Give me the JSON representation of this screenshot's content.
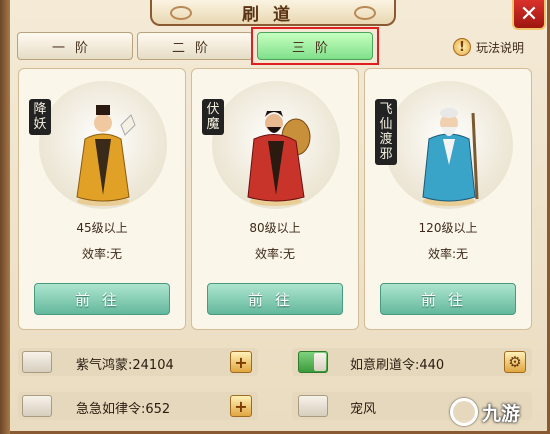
{
  "header": {
    "title": "刷道",
    "close_label": "✕"
  },
  "tabs": [
    {
      "label": "一阶",
      "active": false
    },
    {
      "label": "二阶",
      "active": false
    },
    {
      "label": "三阶",
      "active": true
    }
  ],
  "help": {
    "icon": "!",
    "label": "玩法说明"
  },
  "cards": [
    {
      "badge": "降妖",
      "level": "45级以上",
      "efficiency": "效率:无",
      "button": "前往",
      "robe_color": "#e0a126"
    },
    {
      "badge": "伏魔",
      "level": "80级以上",
      "efficiency": "效率:无",
      "button": "前往",
      "robe_color": "#c8342a"
    },
    {
      "badge": "飞仙渡邪",
      "level": "120级以上",
      "efficiency": "效率:无",
      "button": "前往",
      "robe_color": "#3aa3c8"
    }
  ],
  "items": [
    {
      "label": "紫气鸿蒙:24104",
      "toggle_on": false,
      "action": "+"
    },
    {
      "label": "如意刷道令:440",
      "toggle_on": true,
      "action": "⚙"
    },
    {
      "label": "急急如律令:652",
      "toggle_on": false,
      "action": "+"
    },
    {
      "label": "宠风",
      "toggle_on": false,
      "action": ""
    }
  ],
  "watermark": "九游",
  "colors": {
    "accent_green": "#7fe08a",
    "highlight_red": "#e02020"
  }
}
